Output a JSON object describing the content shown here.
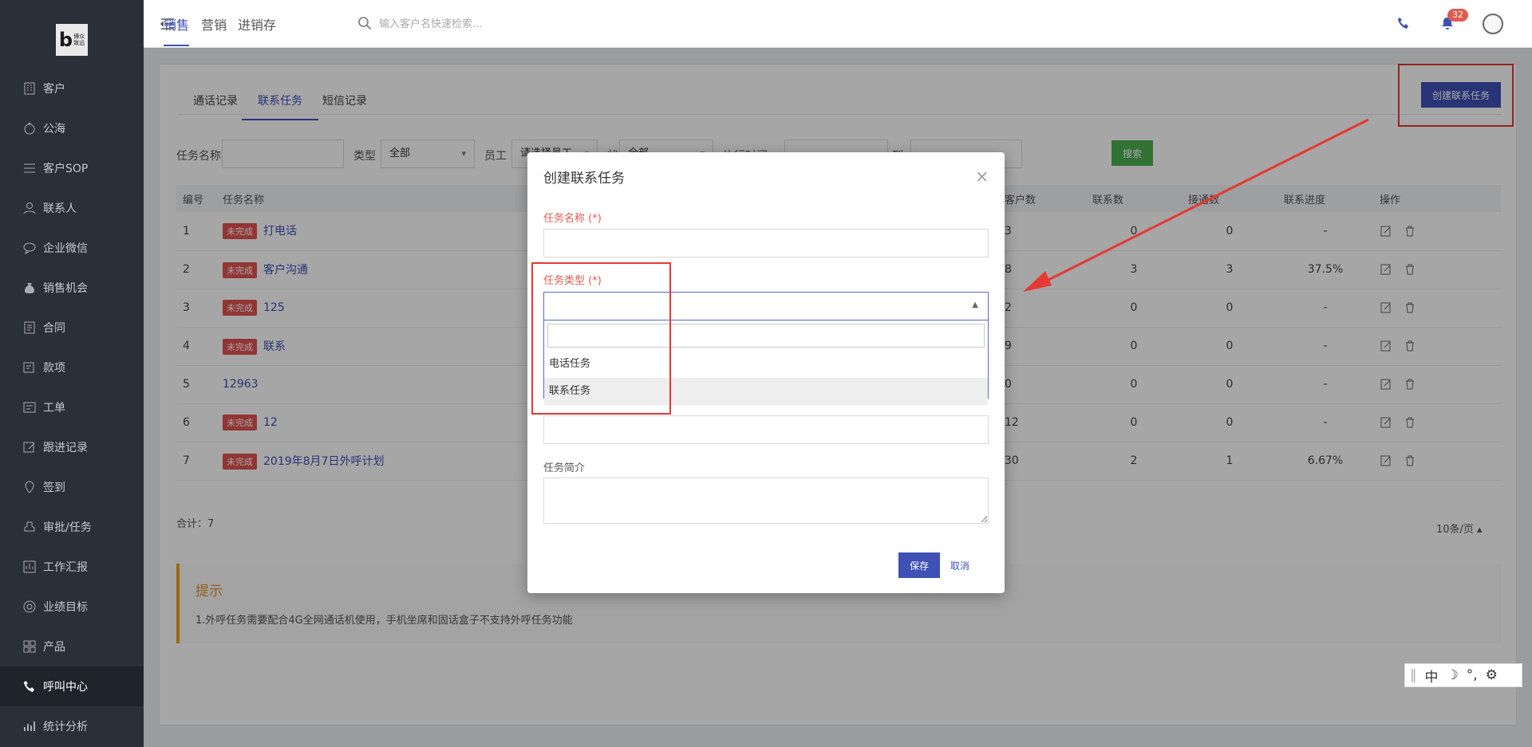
{
  "logo": {
    "letter": "b",
    "text": "博众\n致远"
  },
  "sidebar": {
    "items": [
      {
        "label": "客户",
        "icon": "building-icon"
      },
      {
        "label": "公海",
        "icon": "sea-icon"
      },
      {
        "label": "客户SOP",
        "icon": "sop-icon"
      },
      {
        "label": "联系人",
        "icon": "person-icon"
      },
      {
        "label": "企业微信",
        "icon": "chat-icon"
      },
      {
        "label": "销售机会",
        "icon": "moneybag-icon"
      },
      {
        "label": "合同",
        "icon": "contract-icon"
      },
      {
        "label": "款项",
        "icon": "payment-icon"
      },
      {
        "label": "工单",
        "icon": "ticket-icon"
      },
      {
        "label": "跟进记录",
        "icon": "edit-icon"
      },
      {
        "label": "签到",
        "icon": "location-icon"
      },
      {
        "label": "审批/任务",
        "icon": "approval-icon"
      },
      {
        "label": "工作汇报",
        "icon": "report-icon"
      },
      {
        "label": "业绩目标",
        "icon": "target-icon"
      },
      {
        "label": "产品",
        "icon": "grid-icon"
      },
      {
        "label": "呼叫中心",
        "icon": "phone-icon"
      },
      {
        "label": "统计分析",
        "icon": "chart-icon"
      }
    ],
    "active_index": 15
  },
  "topbar": {
    "tabs": [
      "销售",
      "营销",
      "进销存"
    ],
    "search_placeholder": "输入客户名快速检索...",
    "notification_count": "32"
  },
  "page": {
    "tabs": [
      "通话记录",
      "联系任务",
      "短信记录"
    ],
    "create_button": "创建联系任务",
    "filters": {
      "task_name_label": "任务名称",
      "type_label": "类型",
      "type_value": "全部",
      "employee_label": "员工",
      "employee_value": "请选择员工",
      "status_label": "状态",
      "status_value": "全部",
      "time_label": "执行时间",
      "to_label": "到",
      "search_button": "搜索"
    },
    "table": {
      "headers": [
        "编号",
        "任务名称",
        "客户数",
        "联系数",
        "接通数",
        "联系进度",
        "操作"
      ],
      "rows": [
        {
          "id": "1",
          "tag": "未完成",
          "name": "打电话",
          "customers": "3",
          "contacts": "0",
          "connected": "0",
          "progress": "-"
        },
        {
          "id": "2",
          "tag": "未完成",
          "name": "客户沟通",
          "customers": "8",
          "contacts": "3",
          "connected": "3",
          "progress": "37.5%"
        },
        {
          "id": "3",
          "tag": "未完成",
          "name": "125",
          "customers": "2",
          "contacts": "0",
          "connected": "0",
          "progress": "-"
        },
        {
          "id": "4",
          "tag": "未完成",
          "name": "联系",
          "customers": "9",
          "contacts": "0",
          "connected": "0",
          "progress": "-"
        },
        {
          "id": "5",
          "tag": "",
          "name": "12963",
          "customers": "0",
          "contacts": "0",
          "connected": "0",
          "progress": "-"
        },
        {
          "id": "6",
          "tag": "未完成",
          "name": "12",
          "customers": "12",
          "contacts": "0",
          "connected": "0",
          "progress": "-"
        },
        {
          "id": "7",
          "tag": "未完成",
          "name": "2019年8月7日外呼计划",
          "customers": "30",
          "contacts": "2",
          "connected": "1",
          "progress": "6.67%"
        }
      ]
    },
    "total": "合计：7",
    "page_size": "10条/页 ▴",
    "tip": {
      "title": "提示",
      "text": "1.外呼任务需要配合4G全网通话机使用，手机坐席和固话盒子不支持外呼任务功能"
    }
  },
  "modal": {
    "title": "创建联系任务",
    "close": "×",
    "task_name_label": "任务名称 (*)",
    "task_type_label": "任务类型 (*)",
    "dropdown_options": [
      "电话任务",
      "联系任务"
    ],
    "intro_label": "任务简介",
    "save_button": "保存",
    "cancel_button": "取消"
  },
  "ime": {
    "lang": "中",
    "moon": "☽",
    "punct": "°,",
    "gear": "⚙"
  },
  "colors": {
    "primary": "#3f51b5",
    "danger": "#e05252",
    "success": "#4caf50",
    "sidebar": "#2b2f3a",
    "highlight": "#e53935"
  }
}
